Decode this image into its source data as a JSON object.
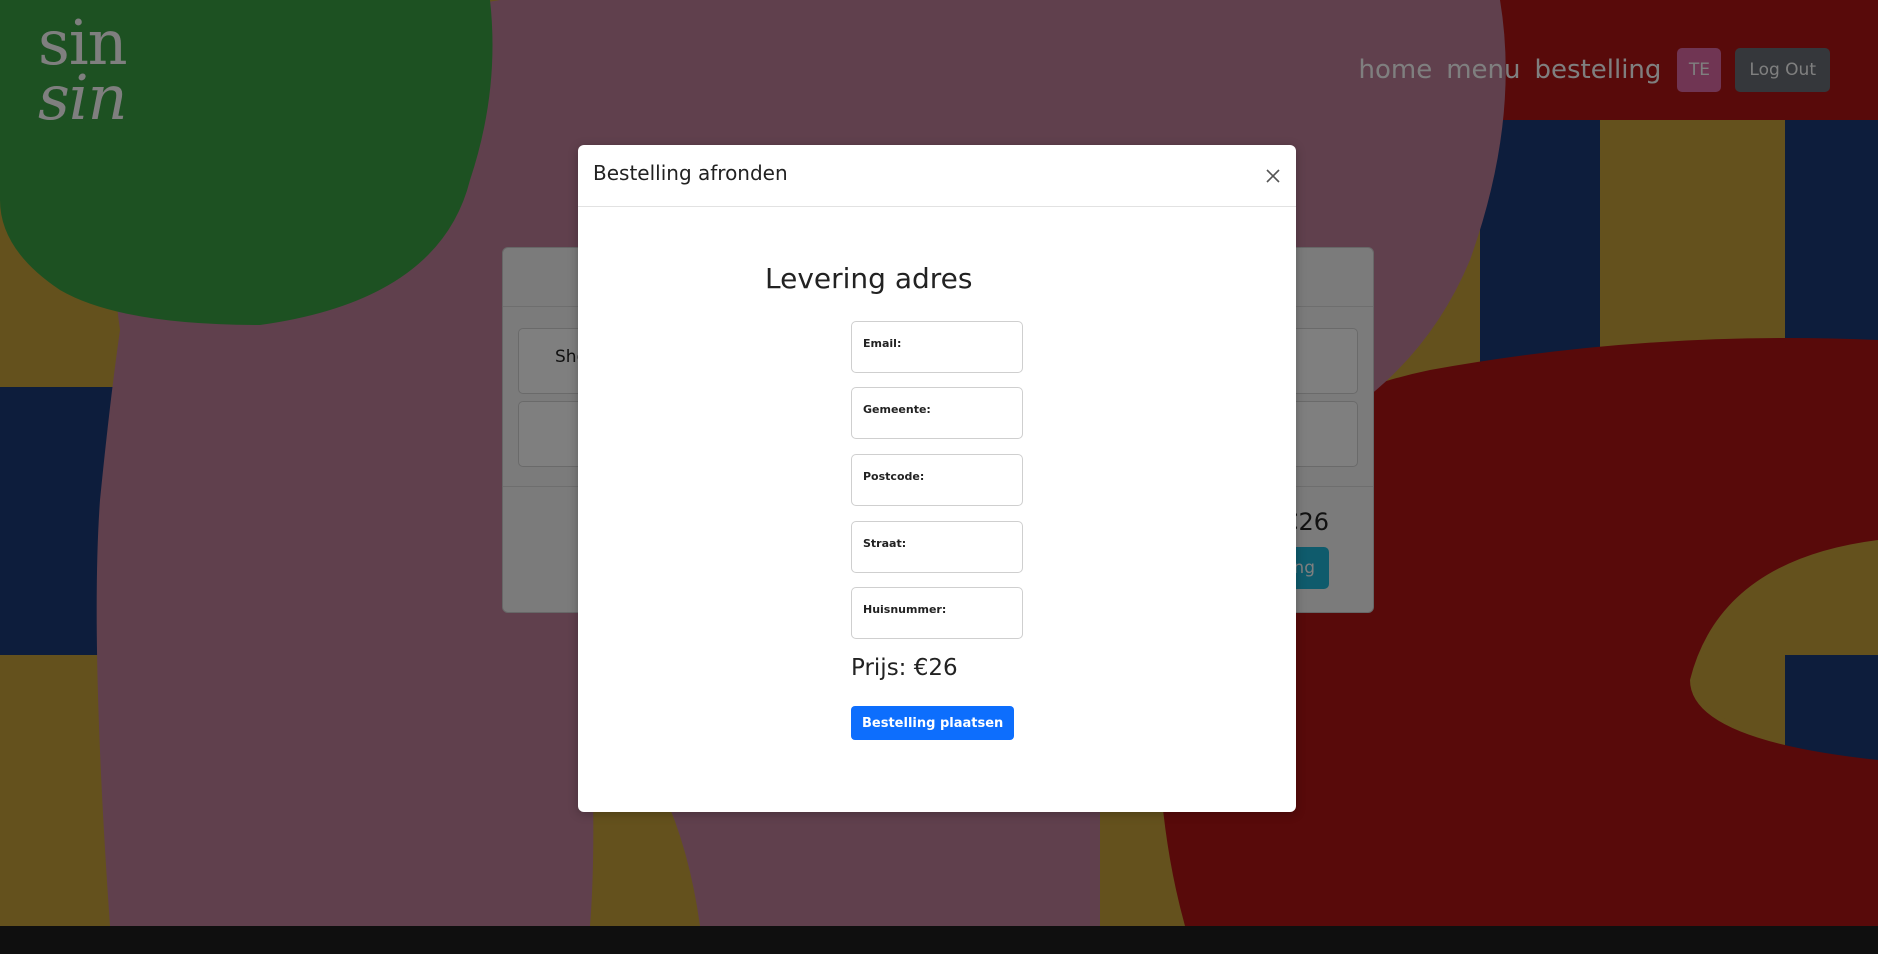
{
  "logo": {
    "line1": "sin",
    "line2": "sin"
  },
  "nav": {
    "links": [
      "home",
      "menu",
      "bestelling"
    ],
    "avatar_initials": "TE",
    "logout_label": "Log Out"
  },
  "card": {
    "item_text": "Sho",
    "total": "€26",
    "button_label": "ng"
  },
  "modal": {
    "title": "Bestelling afronden",
    "close_icon": "close-icon",
    "form_title": "Levering adres",
    "fields": [
      {
        "label": "Email:",
        "value": ""
      },
      {
        "label": "Gemeente:",
        "value": ""
      },
      {
        "label": "Postcode:",
        "value": ""
      },
      {
        "label": "Straat:",
        "value": ""
      },
      {
        "label": "Huisnummer:",
        "value": ""
      }
    ],
    "price": "Prijs: €26",
    "submit_label": "Bestelling plaatsen"
  },
  "colors": {
    "navy": "#1b3a78",
    "mustard": "#c9a23a",
    "crimson": "#b01515",
    "mauve": "#c0809a",
    "green": "#3aa344",
    "primary_button": "#0d6efd"
  }
}
